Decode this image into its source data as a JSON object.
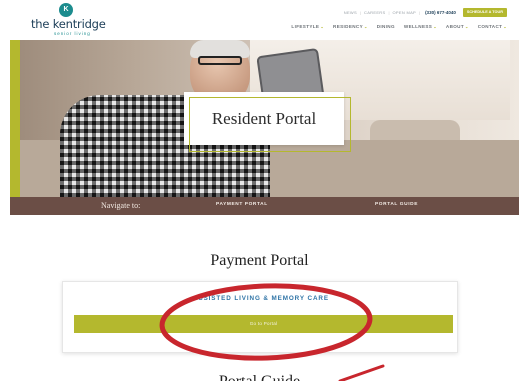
{
  "header": {
    "logo": {
      "mark": "K",
      "name": "the kentridge",
      "sub": "senior living"
    },
    "utility": {
      "links": [
        "NEWS",
        "CAREERS",
        "OPEN MAP"
      ],
      "phone": "(330) 677-4040",
      "cta": "SCHEDULE A TOUR"
    },
    "nav": [
      {
        "label": "LIFESTYLE",
        "has_dropdown": true
      },
      {
        "label": "RESIDENCY",
        "has_dropdown": true
      },
      {
        "label": "DINING",
        "has_dropdown": false
      },
      {
        "label": "WELLNESS",
        "has_dropdown": true
      },
      {
        "label": "ABOUT",
        "has_dropdown": true
      },
      {
        "label": "CONTACT",
        "has_dropdown": true
      }
    ],
    "chevron_icon": "chevron-down-icon"
  },
  "hero": {
    "title": "Resident Portal"
  },
  "navigate_bar": {
    "label": "Navigate to:",
    "links": [
      "PAYMENT PORTAL",
      "PORTAL GUIDE"
    ]
  },
  "payment": {
    "title": "Payment Portal",
    "card_heading": "ASSISTED LIVING & MEMORY CARE",
    "button_label": "Go to Portal"
  },
  "next_section": {
    "title": "Portal Guide"
  },
  "colors": {
    "brand_teal": "#1c8c8e",
    "brand_navy": "#1b3d57",
    "accent_olive": "#b4b82e",
    "nav_brown": "#6b4e46",
    "heading_blue": "#2f74a6",
    "annotation_red": "#c8262d"
  }
}
